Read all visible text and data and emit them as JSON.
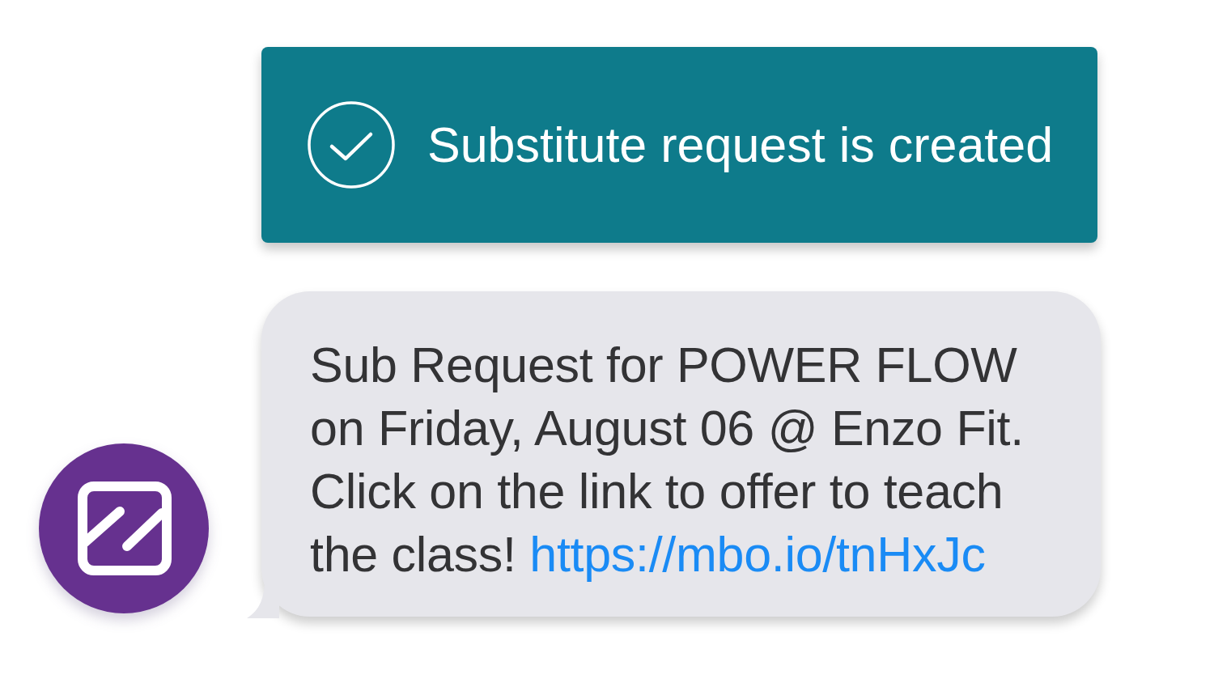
{
  "toast": {
    "kind": "success",
    "message": "Substitute request is created"
  },
  "sms": {
    "text": "Sub Request for POWER FLOW on Friday, August 06 @ Enzo Fit. Click on the link to offer to teach the class!",
    "link": "https://mbo.io/tnHxJc"
  }
}
